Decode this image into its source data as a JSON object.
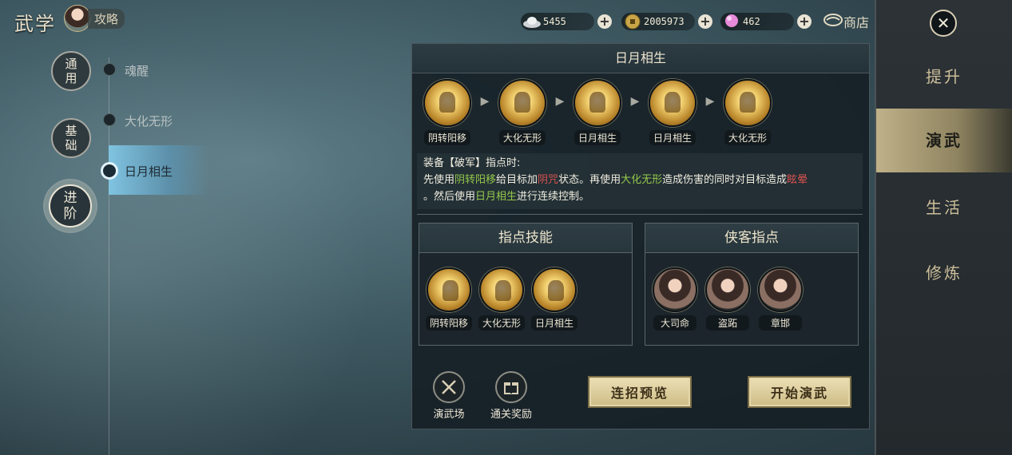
{
  "header": {
    "title": "武学",
    "guide_label": "攻略"
  },
  "currencies": [
    {
      "name": "silver",
      "icon": "silver-ingot-icon",
      "value": "5455"
    },
    {
      "name": "copper",
      "icon": "copper-coin-icon",
      "value": "2005973"
    },
    {
      "name": "gem",
      "icon": "pink-gem-icon",
      "value": "462"
    }
  ],
  "shop_label": "商店",
  "right_nav": [
    {
      "label": "提升",
      "active": false
    },
    {
      "label": "演武",
      "active": true
    },
    {
      "label": "生活",
      "active": false
    },
    {
      "label": "修炼",
      "active": false
    }
  ],
  "left_nav": {
    "categories": [
      "通\n用",
      "基\n础",
      "进\n阶"
    ],
    "cat_lines": [
      [
        "通",
        "用"
      ],
      [
        "基",
        "础"
      ],
      [
        "进",
        "阶"
      ]
    ],
    "subitems": [
      "魂醒",
      "大化无形",
      "日月相生"
    ]
  },
  "panel": {
    "title": "日月相生",
    "combo": [
      "阴转阳移",
      "大化无形",
      "日月相生",
      "日月相生",
      "大化无形"
    ],
    "desc": {
      "line1": "装备【破军】指点时:",
      "p1": "先使用",
      "s1": "阴转阳移",
      "p2": "给目标加",
      "s2": "阴咒",
      "p3": "状态。再使用",
      "s3": "大化无形",
      "p4": "造成伤害的同时对目标造成",
      "s4": "眩晕",
      "p5": "。然后使用",
      "s5": "日月相生",
      "p6": "进行连续控制。"
    },
    "skills_title": "指点技能",
    "skills": [
      "阴转阳移",
      "大化无形",
      "日月相生"
    ],
    "heroes_title": "侠客指点",
    "heroes": [
      "大司命",
      "盗跖",
      "章邯"
    ]
  },
  "bottom": {
    "arena": "演武场",
    "reward": "通关奖励",
    "preview_btn": "连招预览",
    "start_btn": "开始演武"
  },
  "colors": {
    "highlight_green": "#95c84a",
    "highlight_red": "#d9534f",
    "active_tab": "#bfb189",
    "selected_sub": "#82c8e6"
  }
}
